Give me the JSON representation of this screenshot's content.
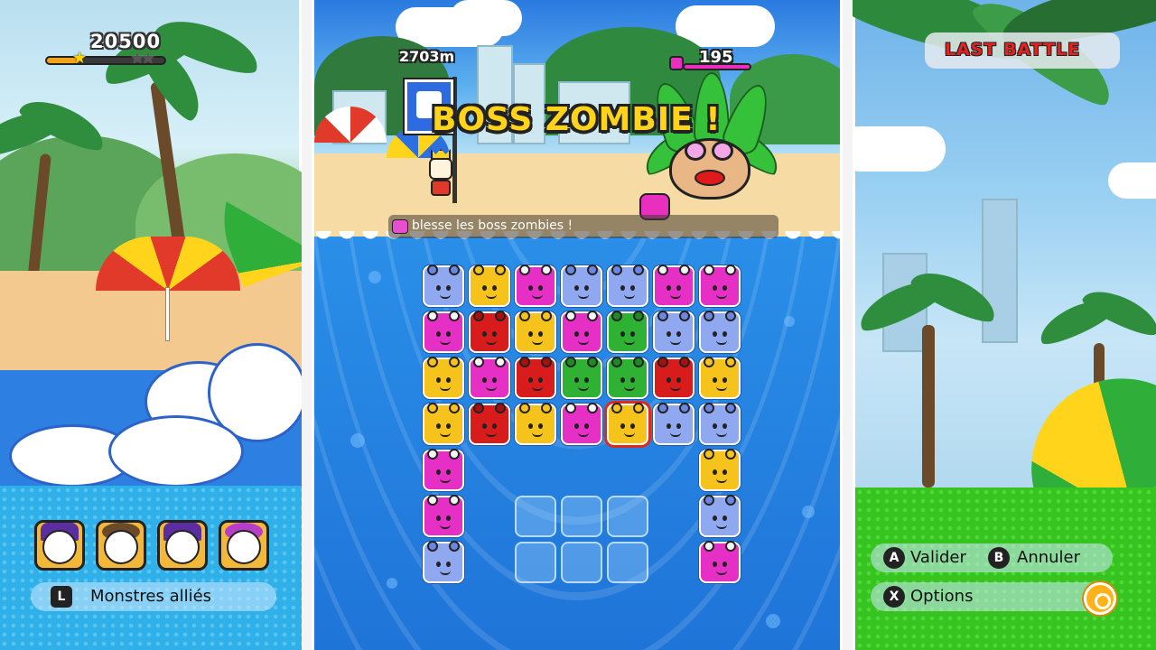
{
  "hud": {
    "score": "20500",
    "score_progress_percent": 28,
    "stars_earned": 1,
    "stars_total": 3
  },
  "battle": {
    "distance": "2703m",
    "boss_title": "BOSS ZOMBIE !",
    "boss_hp": "195",
    "hint": "blesse les boss zombies !",
    "stage_badge": "LAST BATTLE"
  },
  "allies": {
    "label": "Monstres alliés",
    "key": "L",
    "slots": [
      "ally-monster-1",
      "ally-monster-2",
      "ally-monster-3",
      "ally-monster-4"
    ]
  },
  "controls": {
    "confirm_key": "A",
    "confirm_label": "Valider",
    "cancel_key": "B",
    "cancel_label": "Annuler",
    "options_key": "X",
    "options_label": "Options"
  },
  "tile_colors": {
    "blue": "#8fa8f0",
    "yellow": "#f6c21c",
    "pink": "#e62fc4",
    "red": "#d81b1b",
    "green": "#2fb234"
  },
  "board": {
    "columns": 7,
    "rows": [
      [
        "blue",
        "yellow",
        "pink",
        "blue",
        "blue",
        "pink",
        "pink"
      ],
      [
        "pink",
        "red",
        "yellow",
        "pink",
        "green",
        "blue",
        "blue"
      ],
      [
        "yellow",
        "pink",
        "red",
        "green",
        "green",
        "red",
        "yellow"
      ],
      [
        "yellow",
        "red",
        "yellow",
        "pink",
        "yellow",
        "blue",
        "blue"
      ],
      [
        "pink",
        null,
        null,
        null,
        null,
        null,
        "yellow"
      ],
      [
        "pink",
        null,
        null,
        null,
        null,
        null,
        "blue"
      ],
      [
        "blue",
        null,
        null,
        null,
        null,
        null,
        "pink"
      ]
    ],
    "selected": [
      3,
      4
    ],
    "empty_slots": [
      [
        5,
        2
      ],
      [
        5,
        3
      ],
      [
        5,
        4
      ],
      [
        6,
        2
      ],
      [
        6,
        3
      ],
      [
        6,
        4
      ]
    ]
  }
}
